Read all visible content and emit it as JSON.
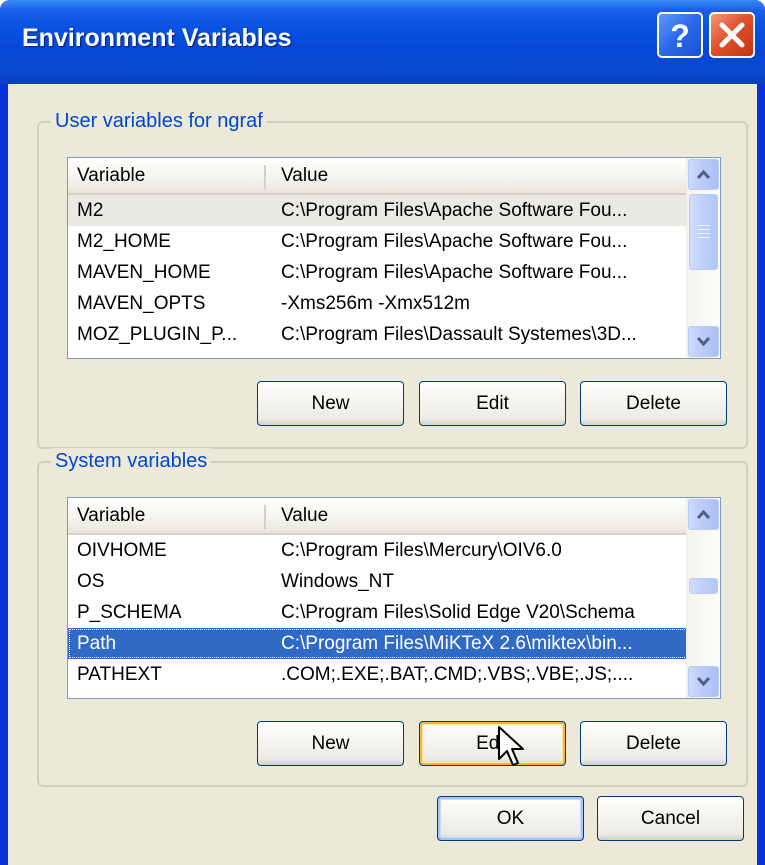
{
  "window": {
    "title": "Environment Variables"
  },
  "user_group": {
    "title": "User variables for ngraf",
    "columns": [
      "Variable",
      "Value"
    ],
    "rows": [
      {
        "variable": "M2",
        "value": "C:\\Program Files\\Apache Software Fou..."
      },
      {
        "variable": "M2_HOME",
        "value": "C:\\Program Files\\Apache Software Fou..."
      },
      {
        "variable": "MAVEN_HOME",
        "value": "C:\\Program Files\\Apache Software Fou..."
      },
      {
        "variable": "MAVEN_OPTS",
        "value": "-Xms256m -Xmx512m"
      },
      {
        "variable": "MOZ_PLUGIN_P...",
        "value": "C:\\Program Files\\Dassault Systemes\\3D..."
      }
    ],
    "buttons": {
      "new": "New",
      "edit": "Edit",
      "delete": "Delete"
    }
  },
  "system_group": {
    "title": "System variables",
    "columns": [
      "Variable",
      "Value"
    ],
    "rows": [
      {
        "variable": "OIVHOME",
        "value": "C:\\Program Files\\Mercury\\OIV6.0"
      },
      {
        "variable": "OS",
        "value": "Windows_NT"
      },
      {
        "variable": "P_SCHEMA",
        "value": "C:\\Program Files\\Solid Edge V20\\Schema"
      },
      {
        "variable": "Path",
        "value": "C:\\Program Files\\MiKTeX 2.6\\miktex\\bin..."
      },
      {
        "variable": "PATHEXT",
        "value": ".COM;.EXE;.BAT;.CMD;.VBS;.VBE;.JS;...."
      }
    ],
    "selected_row_index": 3,
    "buttons": {
      "new": "New",
      "edit": "Edit",
      "delete": "Delete"
    }
  },
  "dialog_buttons": {
    "ok": "OK",
    "cancel": "Cancel"
  },
  "icons": {
    "help": "help-icon",
    "close": "close-icon",
    "scroll_up": "arrow-up-icon",
    "scroll_down": "arrow-down-icon",
    "cursor": "mouse-pointer-icon"
  },
  "colors": {
    "title_bar": "#0a53e3",
    "client_bg": "#ece9d8",
    "group_title": "#0046d5",
    "selection": "#316ac5",
    "hot_button_border": "#f8b33e",
    "close_button": "#e0522f"
  }
}
